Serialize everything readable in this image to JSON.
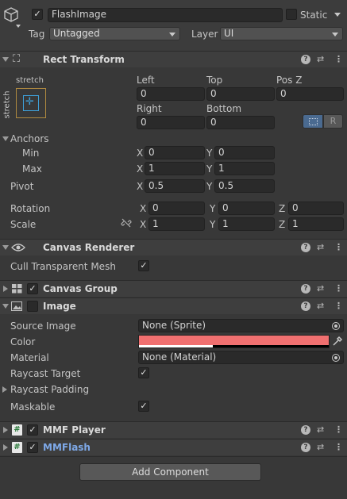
{
  "header": {
    "object_name": "FlashImage",
    "static_label": "Static",
    "tag_label": "Tag",
    "tag_value": "Untagged",
    "layer_label": "Layer",
    "layer_value": "UI"
  },
  "rect_transform": {
    "title": "Rect Transform",
    "stretch_top": "stretch",
    "stretch_side": "stretch",
    "left_label": "Left",
    "top_label": "Top",
    "posz_label": "Pos Z",
    "left_value": "0",
    "top_value": "0",
    "posz_value": "0",
    "right_label": "Right",
    "bottom_label": "Bottom",
    "right_value": "0",
    "bottom_value": "0",
    "r_button": "R",
    "anchors_label": "Anchors",
    "min_label": "Min",
    "max_label": "Max",
    "min_x": "0",
    "min_y": "0",
    "max_x": "1",
    "max_y": "1",
    "pivot_label": "Pivot",
    "pivot_x": "0.5",
    "pivot_y": "0.5",
    "rotation_label": "Rotation",
    "rot_x": "0",
    "rot_y": "0",
    "rot_z": "0",
    "scale_label": "Scale",
    "scale_x": "1",
    "scale_y": "1",
    "scale_z": "1",
    "x": "X",
    "y": "Y",
    "z": "Z"
  },
  "canvas_renderer": {
    "title": "Canvas Renderer",
    "cull_label": "Cull Transparent Mesh"
  },
  "canvas_group": {
    "title": "Canvas Group"
  },
  "image": {
    "title": "Image",
    "source_label": "Source Image",
    "source_value": "None (Sprite)",
    "color_label": "Color",
    "color_hex": "#f07070",
    "alpha_fraction": 0.39,
    "material_label": "Material",
    "material_value": "None (Material)",
    "raycast_target_label": "Raycast Target",
    "raycast_padding_label": "Raycast Padding",
    "maskable_label": "Maskable"
  },
  "mmf_player": {
    "title": "MMF Player"
  },
  "mmflash": {
    "title": "MMFlash",
    "title_color": "#7ea9e8"
  },
  "add_component": "Add Component",
  "icons": {
    "help": "?",
    "presets": "⇄",
    "more": "⋮",
    "check": "✓",
    "hash": "#"
  }
}
